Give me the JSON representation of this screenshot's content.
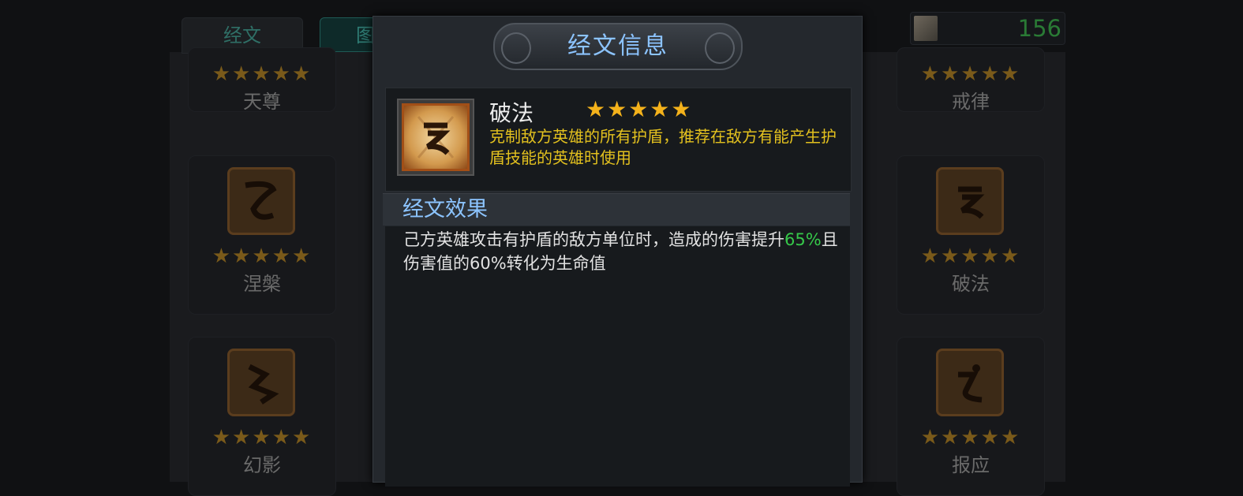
{
  "tabs": [
    "经文",
    "图"
  ],
  "currency": {
    "icon": "scroll-icon",
    "value": "156"
  },
  "colors": {
    "title": "#8cc4ff",
    "desc": "#e3c11e",
    "highlight": "#36c94a",
    "star": "#f4b21b"
  },
  "grid": {
    "left": [
      {
        "name": "天尊",
        "stars": "★★★★★",
        "icon": "rune-tianzun-icon"
      },
      {
        "name": "涅槃",
        "stars": "★★★★★",
        "icon": "rune-niepan-icon"
      },
      {
        "name": "幻影",
        "stars": "★★★★★",
        "icon": "rune-huanying-icon"
      }
    ],
    "right": [
      {
        "name": "戒律",
        "stars": "★★★★★",
        "icon": "rune-jielv-icon"
      },
      {
        "name": "破法",
        "stars": "★★★★★",
        "icon": "rune-pofa-icon"
      },
      {
        "name": "报应",
        "stars": "★★★★★",
        "icon": "rune-baoying-icon"
      }
    ]
  },
  "modal": {
    "title": "经文信息",
    "rune": {
      "name": "破法",
      "stars": "★★★★★",
      "icon": "rune-pofa-icon",
      "description": "克制敌方英雄的所有护盾，推荐在敌方有能产生护盾技能的英雄时使用"
    },
    "effect": {
      "header": "经文效果",
      "text_before": "己方英雄攻击有护盾的敌方单位时，造成的伤害提升",
      "highlight": "65%",
      "text_after": "且伤害值的60%转化为生命值"
    }
  }
}
